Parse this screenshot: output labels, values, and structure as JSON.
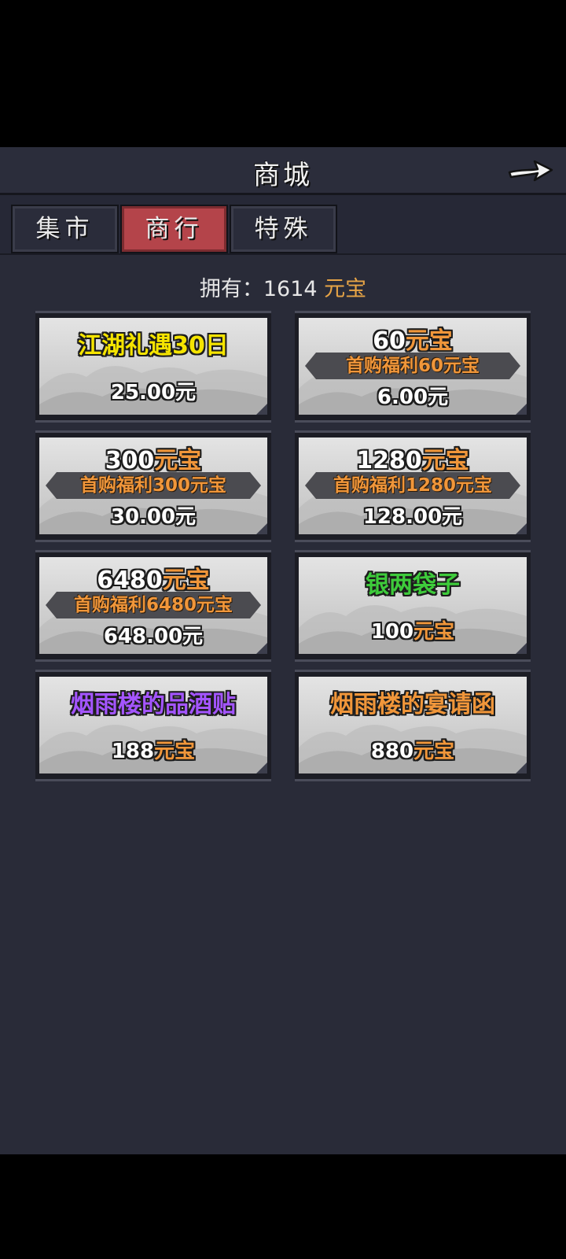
{
  "header": {
    "title": "商城",
    "back_icon": "right-arrow-icon"
  },
  "tabs": [
    {
      "label": "集市",
      "active": false
    },
    {
      "label": "商行",
      "active": true
    },
    {
      "label": "特殊",
      "active": false
    }
  ],
  "balance": {
    "prefix": "拥有：",
    "amount": "1614",
    "currency": "元宝"
  },
  "colors": {
    "gold": "#e7a446",
    "orange": "#f0963a",
    "yellow": "#f5e400",
    "green": "#3ecb3b",
    "purple": "#a455ff",
    "active_tab": "#b4444a"
  },
  "items": [
    {
      "name": "江湖礼遇30日",
      "name_color": "#f5e400",
      "banner": "",
      "price": "25.00元",
      "price_currency": ""
    },
    {
      "name": "60",
      "name_suffix": "元宝",
      "banner": "首购福利60元宝",
      "price": "6.00元",
      "price_currency": ""
    },
    {
      "name": "300",
      "name_suffix": "元宝",
      "banner": "首购福利300元宝",
      "price": "30.00元",
      "price_currency": ""
    },
    {
      "name": "1280",
      "name_suffix": "元宝",
      "banner": "首购福利1280元宝",
      "price": "128.00元",
      "price_currency": ""
    },
    {
      "name": "6480",
      "name_suffix": "元宝",
      "banner": "首购福利6480元宝",
      "price": "648.00元",
      "price_currency": ""
    },
    {
      "name": "银两袋子",
      "name_color": "#3ecb3b",
      "banner": "",
      "price": "100",
      "price_currency": "元宝"
    },
    {
      "name": "烟雨楼的品酒贴",
      "name_color": "#a455ff",
      "banner": "",
      "price": "188",
      "price_currency": "元宝"
    },
    {
      "name": "烟雨楼的宴请函",
      "name_color": "#f0963a",
      "banner": "",
      "price": "880",
      "price_currency": "元宝"
    }
  ]
}
